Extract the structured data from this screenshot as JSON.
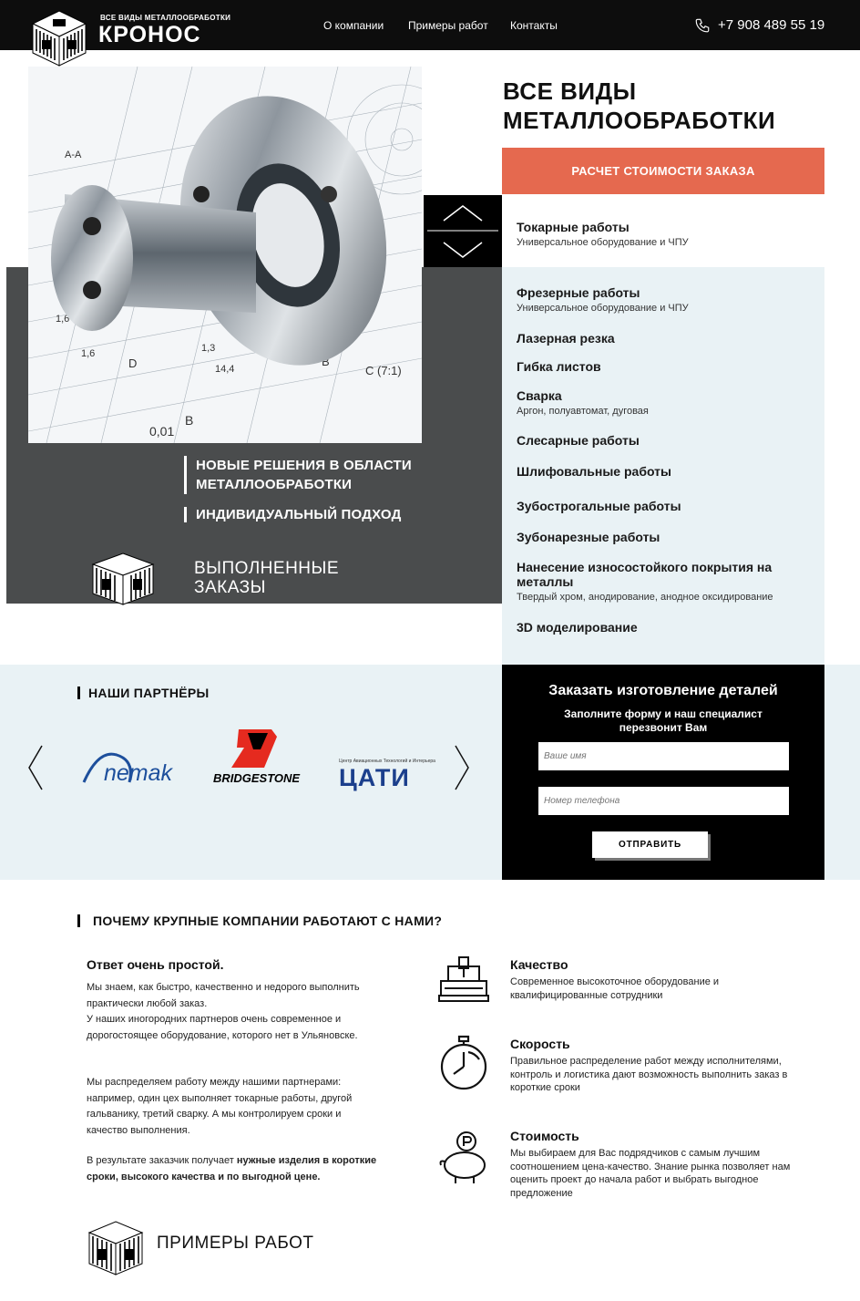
{
  "header": {
    "brand_sub": "ВСЕ ВИДЫ МЕТАЛЛООБРАБОТКИ",
    "brand_name": "КРОНОС",
    "nav": [
      "О компании",
      "Примеры работ",
      "Контакты"
    ],
    "phone": "+7 908 489 55 19"
  },
  "hero": {
    "title_line1": "ВСЕ ВИДЫ",
    "title_line2": "МЕТАЛЛООБРАБОТКИ",
    "cta": "РАСЧЕТ СТОИМОСТИ ЗАКАЗА",
    "tag1_line1": "НОВЫЕ РЕШЕНИЯ В ОБЛАСТИ",
    "tag1_line2": "МЕТАЛЛООБРАБОТКИ",
    "tag2": "ИНДИВИДУАЛЬНЫЙ ПОДХОД",
    "done_line1": "ВЫПОЛНЕННЫЕ",
    "done_line2": "ЗАКАЗЫ",
    "drawing_labels": [
      "А-А",
      "1,6",
      "1,6",
      "1,3",
      "14,4",
      "0,01",
      "B",
      "D",
      "B",
      "C (7:1)"
    ]
  },
  "services": [
    {
      "title": "Токарные работы",
      "sub": "Универсальное оборудование и ЧПУ"
    },
    {
      "title": "Фрезерные работы",
      "sub": "Универсальное оборудование и ЧПУ"
    },
    {
      "title": "Лазерная резка",
      "sub": ""
    },
    {
      "title": "Гибка листов",
      "sub": ""
    },
    {
      "title": "Сварка",
      "sub": "Аргон, полуавтомат, дуговая"
    },
    {
      "title": "Слесарные работы",
      "sub": ""
    },
    {
      "title": "Шлифовальные работы",
      "sub": ""
    },
    {
      "title": "Зубострогальные работы",
      "sub": ""
    },
    {
      "title": "Зубонарезные работы",
      "sub": ""
    },
    {
      "title": "Нанесение износостойкого покрытия на металлы",
      "sub": "Твердый хром, анодирование, анодное оксидирование"
    },
    {
      "title": "3D моделирование",
      "sub": ""
    }
  ],
  "partners": {
    "title": "НАШИ ПАРТНЁРЫ",
    "logos": [
      "nemak",
      "BRIDGESTONE",
      "ЦАТИ"
    ],
    "cati_sub": "Центр Авиационных Технологий и Интерьера"
  },
  "form": {
    "title": "Заказать изготовление деталей",
    "subtitle": "Заполните форму и наш специалист перезвонит Вам",
    "name_placeholder": "Ваше имя",
    "phone_placeholder": "Номер телефона",
    "submit": "ОТПРАВИТЬ"
  },
  "why": {
    "title": "ПОЧЕМУ КРУПНЫЕ КОМПАНИИ РАБОТАЮТ С НАМИ?",
    "answer": "Ответ очень простой.",
    "p1": "Мы знаем, как быстро, качественно и недорого выполнить практически любой заказ.",
    "p2": "У наших иногородних партнеров очень современное и дорогостоящее оборудование, которого нет в Ульяновске.",
    "p3": "Мы распределяем работу между нашими партнерами: например, один цех выполняет токарные работы, другой гальванику, третий сварку. А мы контролируем сроки и качество выполнения.",
    "p4_start": "В результате заказчик получает ",
    "p4_bold": "нужные изделия в короткие сроки, высокого качества и по выгодной цене.",
    "features": [
      {
        "title": "Качество",
        "text": "Современное высокоточное оборудование и квалифицированные сотрудники",
        "icon": "cnc-machine-icon"
      },
      {
        "title": "Скорость",
        "text": "Правильное распределение работ между исполнителями, контроль и логистика дают возможность выполнить заказ в короткие сроки",
        "icon": "stopwatch-icon"
      },
      {
        "title": "Стоимость",
        "text": "Мы выбираем для Вас подрядчиков с самым лучшим соотношением цена-качество. Знание рынка позволяет нам оценить проект до начала работ и выбрать выгодное предложение",
        "icon": "piggy-bank-icon"
      }
    ]
  },
  "examples": {
    "title": "ПРИМЕРЫ РАБОТ"
  },
  "colors": {
    "accent": "#e5694f",
    "dark": "#4a4c4d",
    "light": "#e9f2f5",
    "black": "#0d0d0d"
  }
}
